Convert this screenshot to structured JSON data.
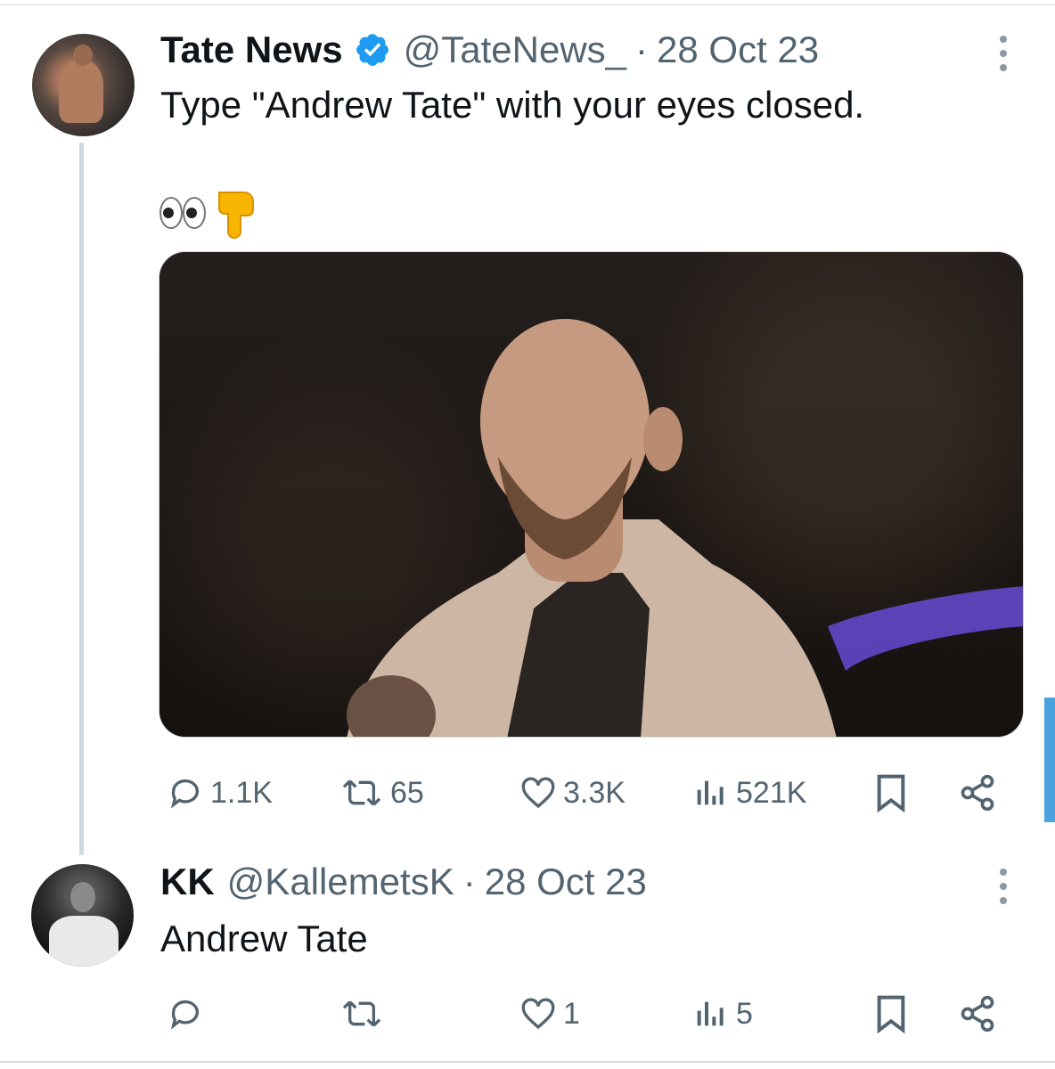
{
  "tweets": [
    {
      "name": "Tate News",
      "handle": "@TateNews_",
      "separator": "·",
      "date": "28 Oct 23",
      "text": "Type \"Andrew Tate\" with your eyes closed.",
      "emojis": [
        "eyes-emoji",
        "backhand-index-pointing-down-emoji"
      ],
      "stats": {
        "replies": "1.1K",
        "reposts": "65",
        "likes": "3.3K",
        "views": "521K"
      },
      "verified": true
    },
    {
      "name": "KK",
      "handle": "@KallemetsK",
      "separator": "·",
      "date": "28 Oct 23",
      "text": "Andrew Tate",
      "stats": {
        "replies": "",
        "reposts": "",
        "likes": "1",
        "views": "5"
      },
      "verified": false
    }
  ],
  "colors": {
    "accent": "#1d9bf0",
    "text": "#0f1419",
    "secondary": "#536471",
    "divider": "#cfd9de"
  }
}
